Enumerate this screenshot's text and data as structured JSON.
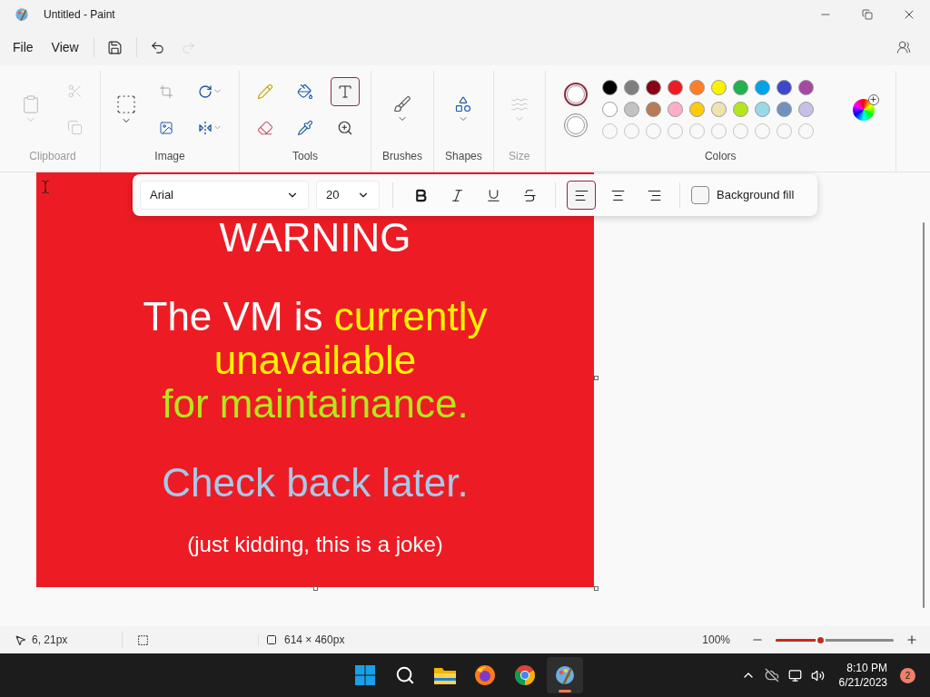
{
  "window": {
    "title": "Untitled - Paint"
  },
  "menu": [
    {
      "label": "File"
    },
    {
      "label": "View"
    }
  ],
  "quick_actions": [
    {
      "kind": "save",
      "disabled": false
    },
    {
      "kind": "undo",
      "disabled": false
    },
    {
      "kind": "redo",
      "disabled": true
    }
  ],
  "ribbon": {
    "groups": [
      {
        "kind": "clipboard",
        "label": "Clipboard",
        "disabled": true
      },
      {
        "kind": "image",
        "label": "Image",
        "disabled": false
      },
      {
        "kind": "tools",
        "label": "Tools",
        "disabled": false
      },
      {
        "kind": "brushes",
        "label": "Brushes",
        "disabled": false
      },
      {
        "kind": "shapes",
        "label": "Shapes",
        "disabled": false
      },
      {
        "kind": "size",
        "label": "Size",
        "disabled": true
      },
      {
        "kind": "colors",
        "label": "Colors",
        "disabled": false
      }
    ]
  },
  "tools": [
    {
      "kind": "pencil",
      "selected": false
    },
    {
      "kind": "fill",
      "selected": false
    },
    {
      "kind": "text",
      "selected": true
    },
    {
      "kind": "eraser",
      "selected": false
    },
    {
      "kind": "picker",
      "selected": false
    },
    {
      "kind": "magnifier",
      "selected": false
    }
  ],
  "current_colors": [
    {
      "color": "#ffffff",
      "selected": true
    },
    {
      "color": "#ffffff",
      "selected": false
    }
  ],
  "palette": [
    {
      "color": "#000000"
    },
    {
      "color": "#7f7f7f"
    },
    {
      "color": "#880015"
    },
    {
      "color": "#ed1c24"
    },
    {
      "color": "#ff7f27"
    },
    {
      "color": "#fff200"
    },
    {
      "color": "#22b14c"
    },
    {
      "color": "#00a2e8"
    },
    {
      "color": "#3f48cc"
    },
    {
      "color": "#a349a4"
    },
    {
      "color": "#ffffff"
    },
    {
      "color": "#c3c3c3"
    },
    {
      "color": "#b97a57"
    },
    {
      "color": "#ffaec9"
    },
    {
      "color": "#ffc90e"
    },
    {
      "color": "#efe4b0"
    },
    {
      "color": "#b5e61d"
    },
    {
      "color": "#99d9ea"
    },
    {
      "color": "#7092be"
    },
    {
      "color": "#c8bfe7"
    }
  ],
  "text_toolbar": {
    "font": "Arial",
    "size": "20",
    "bold": false,
    "italic": false,
    "underline": false,
    "strikethrough": false,
    "align": [
      {
        "kind": "left",
        "selected": true
      },
      {
        "kind": "center",
        "selected": false
      },
      {
        "kind": "right",
        "selected": false
      }
    ],
    "background_fill": {
      "label": "Background fill",
      "checked": false
    }
  },
  "canvas": {
    "lines": [
      {
        "kind": "title",
        "segments": [
          {
            "text": "WARNING",
            "color": "#ffffff"
          }
        ]
      },
      {
        "kind": "first",
        "segments": [
          {
            "text": "The VM is ",
            "color": "#ffffff"
          },
          {
            "text": "currently",
            "color": "#fff200"
          }
        ]
      },
      {
        "kind": "large",
        "segments": [
          {
            "text": "unavailable",
            "color": "#fff200"
          }
        ]
      },
      {
        "kind": "large",
        "segments": [
          {
            "text": "for maintainance.",
            "color": "#b5e61d"
          }
        ]
      },
      {
        "kind": "paragraph",
        "segments": [
          {
            "text": "Check back later.",
            "color": "#a8c8e8"
          }
        ]
      },
      {
        "kind": "small",
        "segments": [
          {
            "text": "(just kidding, this is a joke)",
            "color": "#ffffff"
          }
        ]
      }
    ]
  },
  "status_bar": {
    "cursor": "6, 21px",
    "canvas_size": "614 × 460px",
    "zoom": "100%",
    "zoom_slider": {
      "level": 0.38
    }
  },
  "taskbar": {
    "apps": [
      {
        "kind": "start",
        "running": false
      },
      {
        "kind": "search",
        "running": false
      },
      {
        "kind": "files",
        "running": false
      },
      {
        "kind": "firefox",
        "running": false
      },
      {
        "kind": "chrome",
        "running": false
      },
      {
        "kind": "paint",
        "running": true
      }
    ],
    "time": "8:10 PM",
    "date": "6/21/2023",
    "notifications": "2"
  }
}
